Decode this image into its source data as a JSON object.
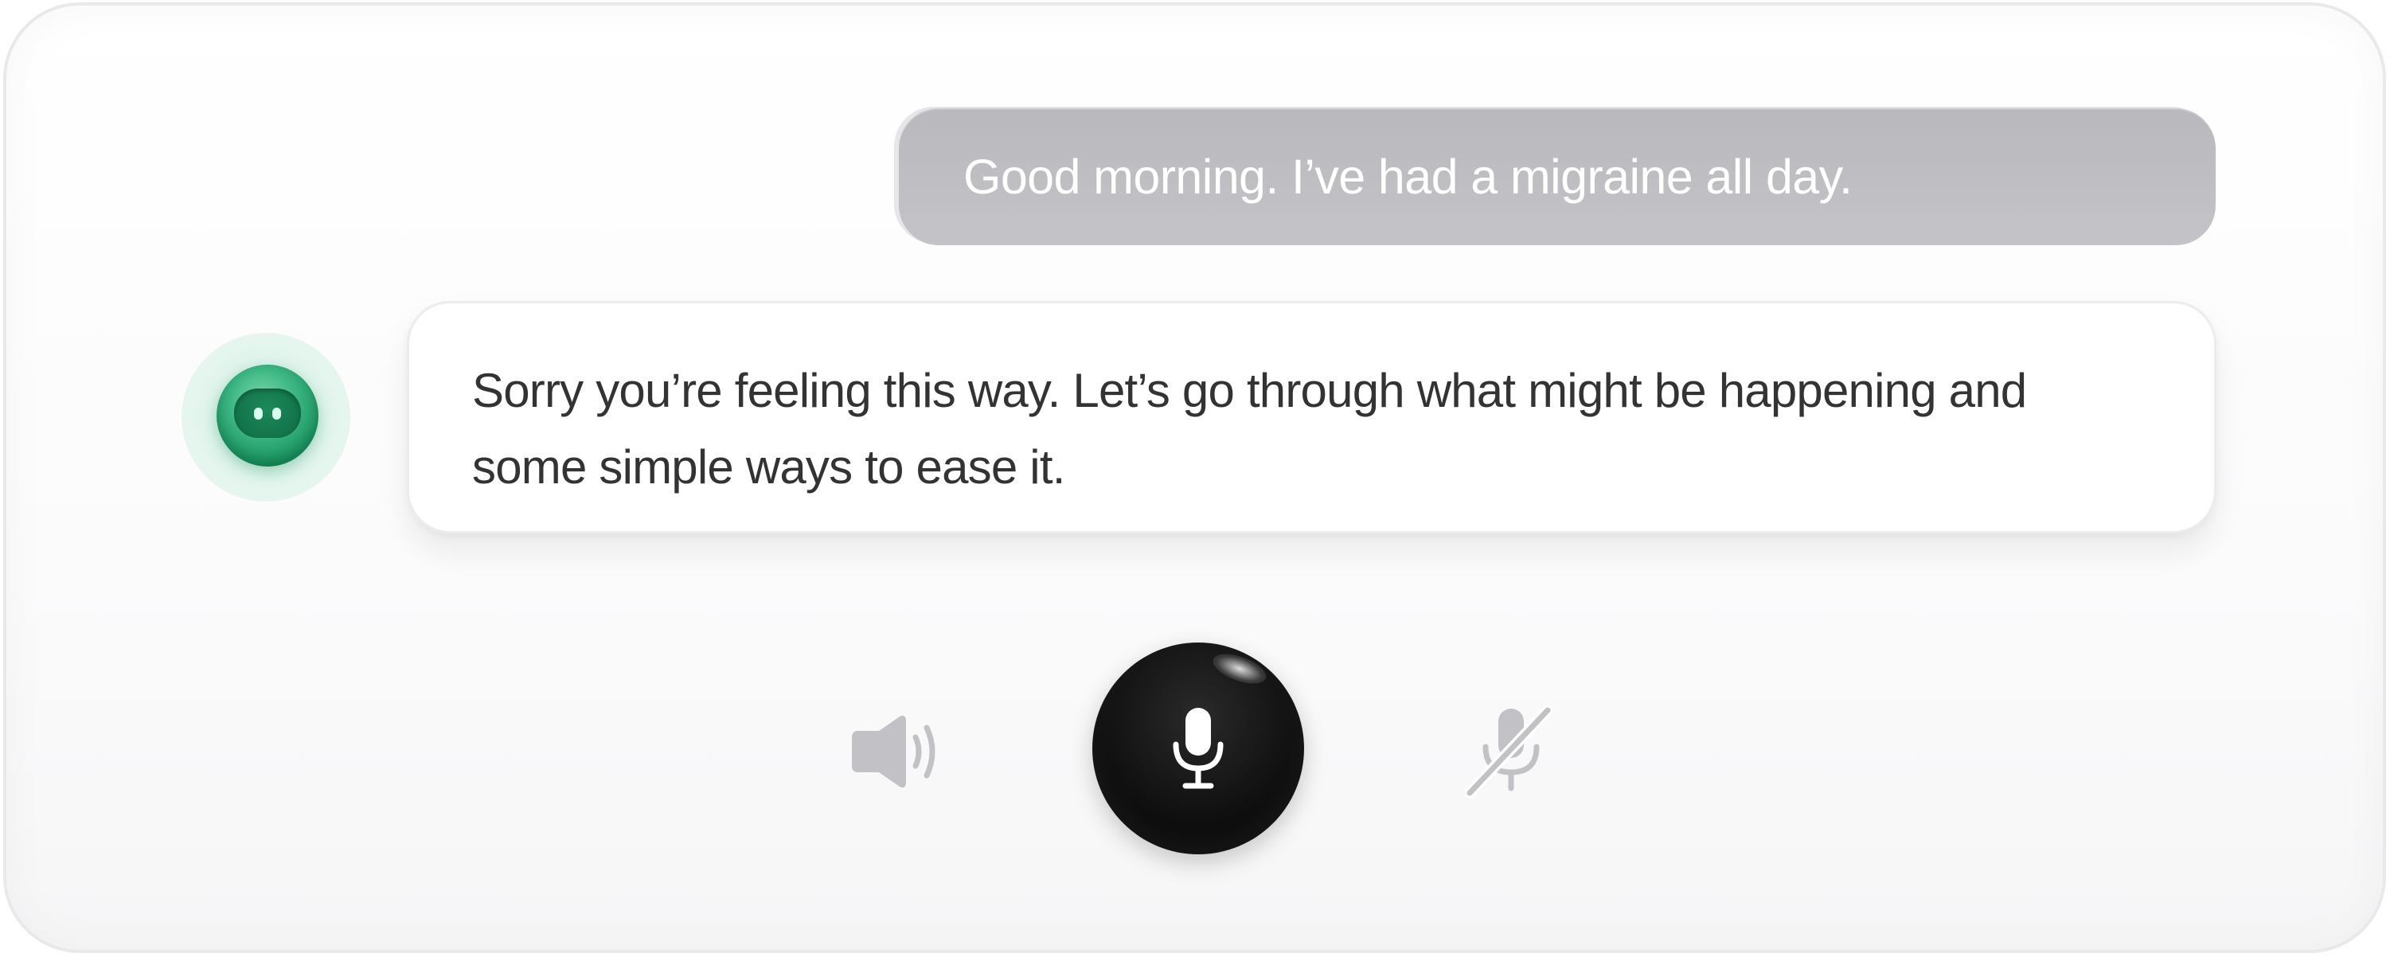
{
  "chat": {
    "messages": [
      {
        "role": "user",
        "text": "Good morning. I’ve had a migraine all day."
      },
      {
        "role": "assistant",
        "text": "Sorry you’re feeling this way. Let’s go through what might be happening and some simple ways to ease it."
      }
    ]
  },
  "controls": {
    "speaker": {
      "icon": "speaker-icon",
      "color": "#c2c2c6"
    },
    "microphone": {
      "icon": "microphone-icon",
      "color": "#000000"
    },
    "mute": {
      "icon": "microphone-off-icon",
      "color": "#c2c2c6"
    }
  },
  "colors": {
    "user_bubble": "#bcbcc0",
    "assistant_bubble": "#ffffff",
    "assistant_text": "#333333",
    "accent_green": "#2fae78"
  }
}
